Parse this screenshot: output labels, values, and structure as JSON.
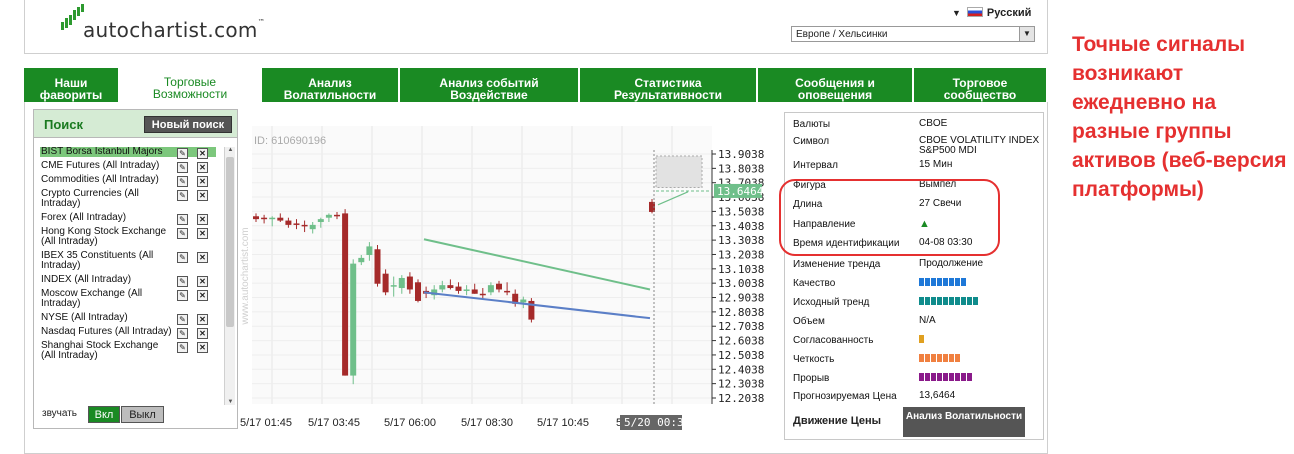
{
  "header": {
    "logo_text": "autochartist.com",
    "logo_tm": "™",
    "language": "Русский",
    "timezone": "Европе / Хельсинки"
  },
  "tabs": [
    {
      "label1": "Наши",
      "label2": "фавориты",
      "w": 96,
      "active": false
    },
    {
      "label1": "Торговые",
      "label2": "Возможности",
      "w": 142,
      "active": true
    },
    {
      "label1": "Анализ",
      "label2": "Волатильности",
      "w": 138,
      "active": false
    },
    {
      "label1": "Анализ событий",
      "label2": "Воздействие",
      "w": 180,
      "active": false
    },
    {
      "label1": "Статистика",
      "label2": "Результативности",
      "w": 178,
      "active": false
    },
    {
      "label1": "Сообщения и",
      "label2": "оповещения",
      "w": 156,
      "active": false
    },
    {
      "label1": "Торговое",
      "label2": "сообщество",
      "w": 134,
      "active": false
    }
  ],
  "search": {
    "title": "Поиск",
    "new_search": "Новый поиск",
    "items": [
      "BIST Borsa Istanbul Majors",
      "CME Futures (All Intraday)",
      "Commodities (All Intraday)",
      "Crypto Currencies (All Intraday)",
      "Forex (All Intraday)",
      "Hong Kong Stock Exchange (All Intraday)",
      "IBEX 35 Constituents (All Intraday)",
      "INDEX (All Intraday)",
      "Moscow Exchange (All Intraday)",
      "NYSE (All Intraday)",
      "Nasdaq Futures (All Intraday)",
      "Shanghai Stock Exchange (All Intraday)"
    ],
    "sound_label": "звучать",
    "on": "Вкл",
    "off": "Выкл"
  },
  "chart": {
    "id_label": "ID: 610690196",
    "watermark": "www.autochartist.com",
    "price_label": "13.6464",
    "time_label": "5/20 00:30"
  },
  "chart_data": {
    "type": "candlestick",
    "ylim": [
      12.2038,
      13.9038
    ],
    "y_ticks": [
      "13.9038",
      "13.8038",
      "13.7038",
      "13.6038",
      "13.5038",
      "13.4038",
      "13.3038",
      "13.2038",
      "13.1038",
      "13.0038",
      "12.9038",
      "12.8038",
      "12.7038",
      "12.6038",
      "12.5038",
      "12.4038",
      "12.3038",
      "12.2038"
    ],
    "x_ticks": [
      "5/17 01:45",
      "5/17 03:45",
      "5/17 06:00",
      "5/17 08:30",
      "5/17 10:45",
      "5/20 00:30"
    ],
    "candles": [
      [
        13.47,
        13.49,
        13.43,
        13.45
      ],
      [
        13.46,
        13.48,
        13.42,
        13.45
      ],
      [
        13.45,
        13.47,
        13.4,
        13.46
      ],
      [
        13.46,
        13.49,
        13.43,
        13.44
      ],
      [
        13.44,
        13.46,
        13.39,
        13.41
      ],
      [
        13.42,
        13.45,
        13.38,
        13.41
      ],
      [
        13.41,
        13.44,
        13.36,
        13.4
      ],
      [
        13.38,
        13.43,
        13.35,
        13.41
      ],
      [
        13.43,
        13.46,
        13.39,
        13.45
      ],
      [
        13.46,
        13.49,
        13.43,
        13.48
      ],
      [
        13.48,
        13.5,
        13.45,
        13.47
      ],
      [
        13.49,
        13.52,
        12.36,
        12.36
      ],
      [
        12.36,
        13.17,
        12.3,
        13.14
      ],
      [
        13.15,
        13.2,
        13.13,
        13.18
      ],
      [
        13.2,
        13.29,
        13.16,
        13.26
      ],
      [
        13.24,
        13.27,
        12.98,
        13.0
      ],
      [
        13.07,
        13.1,
        12.92,
        12.94
      ],
      [
        12.98,
        13.05,
        12.91,
        12.99
      ],
      [
        12.97,
        13.06,
        12.93,
        13.04
      ],
      [
        13.05,
        13.08,
        12.93,
        12.96
      ],
      [
        13.01,
        13.03,
        12.87,
        12.88
      ],
      [
        12.95,
        12.98,
        12.9,
        12.93
      ],
      [
        12.92,
        12.99,
        12.89,
        12.96
      ],
      [
        12.96,
        13.02,
        12.94,
        12.99
      ],
      [
        12.99,
        13.03,
        12.96,
        12.97
      ],
      [
        12.98,
        13.01,
        12.93,
        12.95
      ],
      [
        12.95,
        12.99,
        12.92,
        12.96
      ],
      [
        12.96,
        13.0,
        12.93,
        12.93
      ],
      [
        12.93,
        12.97,
        12.89,
        12.92
      ],
      [
        12.94,
        13.01,
        12.92,
        12.99
      ],
      [
        13.0,
        13.02,
        12.94,
        12.96
      ],
      [
        12.95,
        13.01,
        12.92,
        12.94
      ],
      [
        12.93,
        12.96,
        12.84,
        12.86
      ],
      [
        12.87,
        12.91,
        12.83,
        12.89
      ],
      [
        12.88,
        12.9,
        12.73,
        12.75
      ],
      [
        13.57,
        13.59,
        13.49,
        13.5
      ]
    ],
    "pattern_upper": [
      [
        13.28,
        13.31
      ],
      [
        12.97,
        12.97
      ]
    ],
    "pattern_lower": [
      [
        12.94,
        12.76
      ]
    ],
    "forecast_price": 13.6464
  },
  "details": [
    {
      "k": "Валюты",
      "v": "CBOE"
    },
    {
      "k": "Символ",
      "v": "CBOE VOLATILITY INDEX S&P500 MDI"
    },
    {
      "k": "Интервал",
      "v": "15 Мин"
    },
    {
      "k": "Фигура",
      "v": "Вымпел"
    },
    {
      "k": "Длина",
      "v": "27 Свечи"
    },
    {
      "k": "Направление",
      "v": ""
    },
    {
      "k": "Время идентификации",
      "v": "04-08 03:30"
    },
    {
      "k": "Изменение тренда",
      "v": "Продолжение"
    },
    {
      "k": "Качество",
      "v": ""
    },
    {
      "k": "Исходный тренд",
      "v": ""
    },
    {
      "k": "Объем",
      "v": "N/A"
    },
    {
      "k": "Согласованность",
      "v": ""
    },
    {
      "k": "Четкость",
      "v": ""
    },
    {
      "k": "Прорыв",
      "v": ""
    },
    {
      "k": "Прогнозируемая Цена",
      "v": "13,6464"
    }
  ],
  "levels": {
    "quality": {
      "segments": 8,
      "color": "#1e78d8"
    },
    "initial_trend": {
      "segments": 10,
      "color": "#0f8c8c"
    },
    "uniformity": {
      "segments": 1,
      "color": "#e0a020"
    },
    "clarity": {
      "segments": 7,
      "color": "#f08040"
    },
    "breakout": {
      "segments": 9,
      "color": "#8a1a8a"
    }
  },
  "price_movement_label": "Движение Цены",
  "volatility_button": "Анализ Волатильности",
  "caption": "Точные сигналы возникают ежедневно на разные группы активов (веб-версия платформы)",
  "colors": {
    "green": "#1a8a23",
    "bull": "#6fbf8a",
    "bear": "#a52a2a",
    "red_note": "#e53030"
  }
}
